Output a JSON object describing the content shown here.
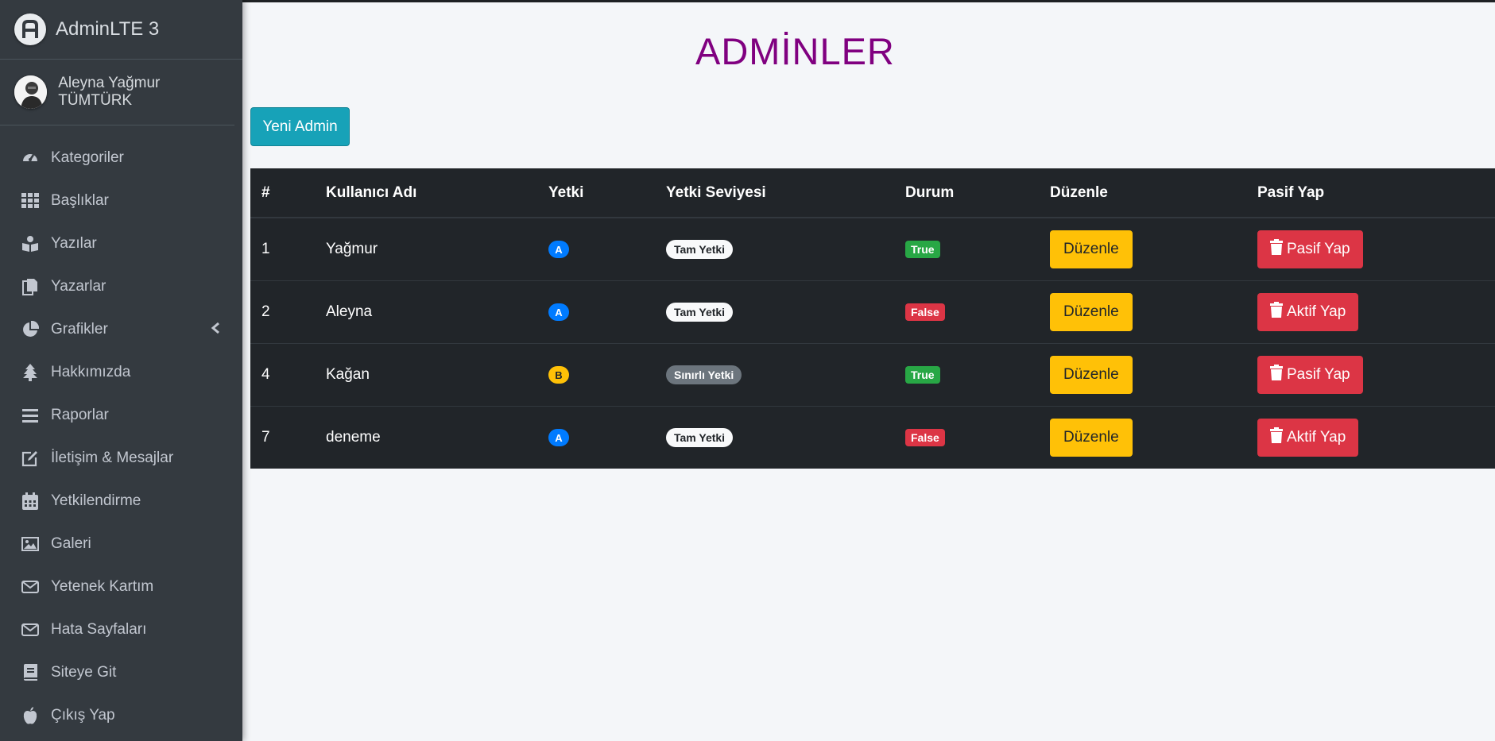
{
  "brand": {
    "name": "AdminLTE 3"
  },
  "user": {
    "name": "Aleyna Yağmur TÜMTÜRK"
  },
  "sidebar": {
    "items": [
      {
        "label": "Kategoriler",
        "icon": "tachometer-icon"
      },
      {
        "label": "Başlıklar",
        "icon": "grid-icon"
      },
      {
        "label": "Yazılar",
        "icon": "book-reader-icon"
      },
      {
        "label": "Yazarlar",
        "icon": "copy-icon"
      },
      {
        "label": "Grafikler",
        "icon": "pie-chart-icon"
      },
      {
        "label": "Hakkımızda",
        "icon": "tree-icon"
      },
      {
        "label": "Raporlar",
        "icon": "bars-icon"
      },
      {
        "label": "İletişim & Mesajlar",
        "icon": "edit-icon"
      },
      {
        "label": "Yetkilendirme",
        "icon": "calendar-icon"
      },
      {
        "label": "Galeri",
        "icon": "image-icon"
      },
      {
        "label": "Yetenek Kartım",
        "icon": "envelope-icon"
      },
      {
        "label": "Hata Sayfaları",
        "icon": "envelope-icon"
      },
      {
        "label": "Siteye Git",
        "icon": "book-icon"
      },
      {
        "label": "Çıkış Yap",
        "icon": "apple-icon"
      }
    ]
  },
  "page": {
    "title": "ADMİNLER",
    "new_button": "Yeni Admin"
  },
  "table": {
    "headers": [
      "#",
      "Kullanıcı Adı",
      "Yetki",
      "Yetki Seviyesi",
      "Durum",
      "Düzenle",
      "Pasif Yap"
    ],
    "rows": [
      {
        "id": "1",
        "username": "Yağmur",
        "role": "A",
        "level": "Tam Yetki",
        "status": "True",
        "edit": "Düzenle",
        "action": "Pasif Yap"
      },
      {
        "id": "2",
        "username": "Aleyna",
        "role": "A",
        "level": "Tam Yetki",
        "status": "False",
        "edit": "Düzenle",
        "action": "Aktif Yap"
      },
      {
        "id": "4",
        "username": "Kağan",
        "role": "B",
        "level": "Sınırlı Yetki",
        "status": "True",
        "edit": "Düzenle",
        "action": "Pasif Yap"
      },
      {
        "id": "7",
        "username": "deneme",
        "role": "A",
        "level": "Tam Yetki",
        "status": "False",
        "edit": "Düzenle",
        "action": "Aktif Yap"
      }
    ]
  },
  "colors": {
    "sidebar_bg": "#343a40",
    "title": "#800080",
    "info": "#17a2b8",
    "table_bg": "#212529",
    "primary": "#007bff",
    "warning": "#ffc107",
    "success": "#28a745",
    "danger": "#dc3545"
  }
}
